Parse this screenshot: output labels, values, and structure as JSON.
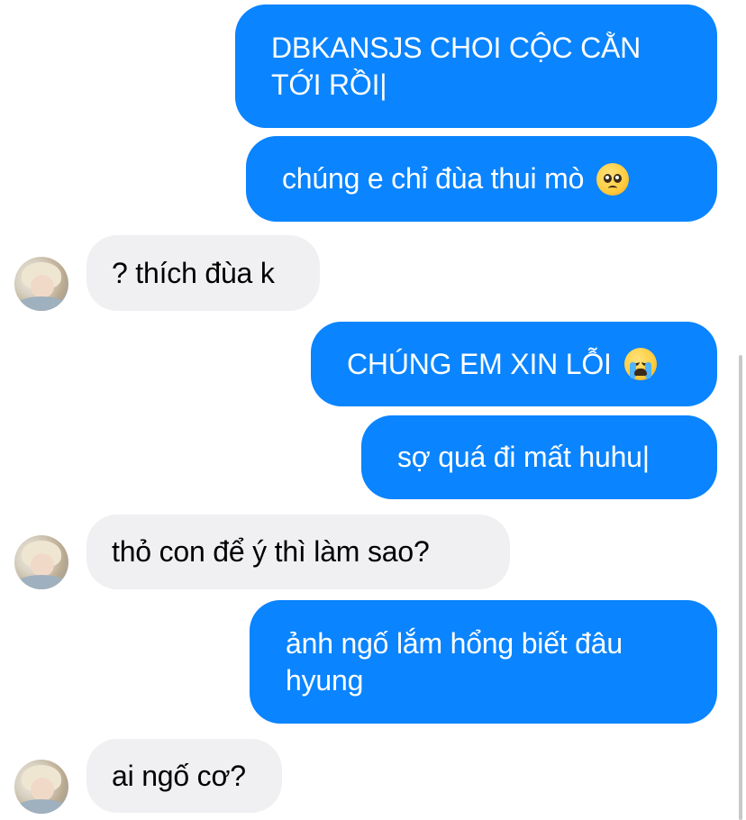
{
  "messages": [
    {
      "side": "sent",
      "text": "DBKANSJS CHOI CỘC CẰN\nTỚI RỒI|"
    },
    {
      "side": "sent",
      "text": "chúng e chỉ đùa thui mò",
      "emoji": "pleading-face-emoji"
    },
    {
      "side": "received",
      "text": "? thích đùa k"
    },
    {
      "side": "sent",
      "text": "CHÚNG EM XIN LỖI",
      "emoji": "loudly-crying-face-emoji"
    },
    {
      "side": "sent",
      "text": "sợ quá đi mất huhu|"
    },
    {
      "side": "received",
      "text": "thỏ con để ý thì làm sao?"
    },
    {
      "side": "sent",
      "text": "ảnh ngố lắm hổng biết đâu\nhyung"
    },
    {
      "side": "received",
      "text": "ai ngố cơ?"
    }
  ],
  "colors": {
    "sent_bubble": "#0a84ff",
    "received_bubble": "#f0f0f2",
    "sent_text": "#ffffff",
    "received_text": "#000000"
  }
}
